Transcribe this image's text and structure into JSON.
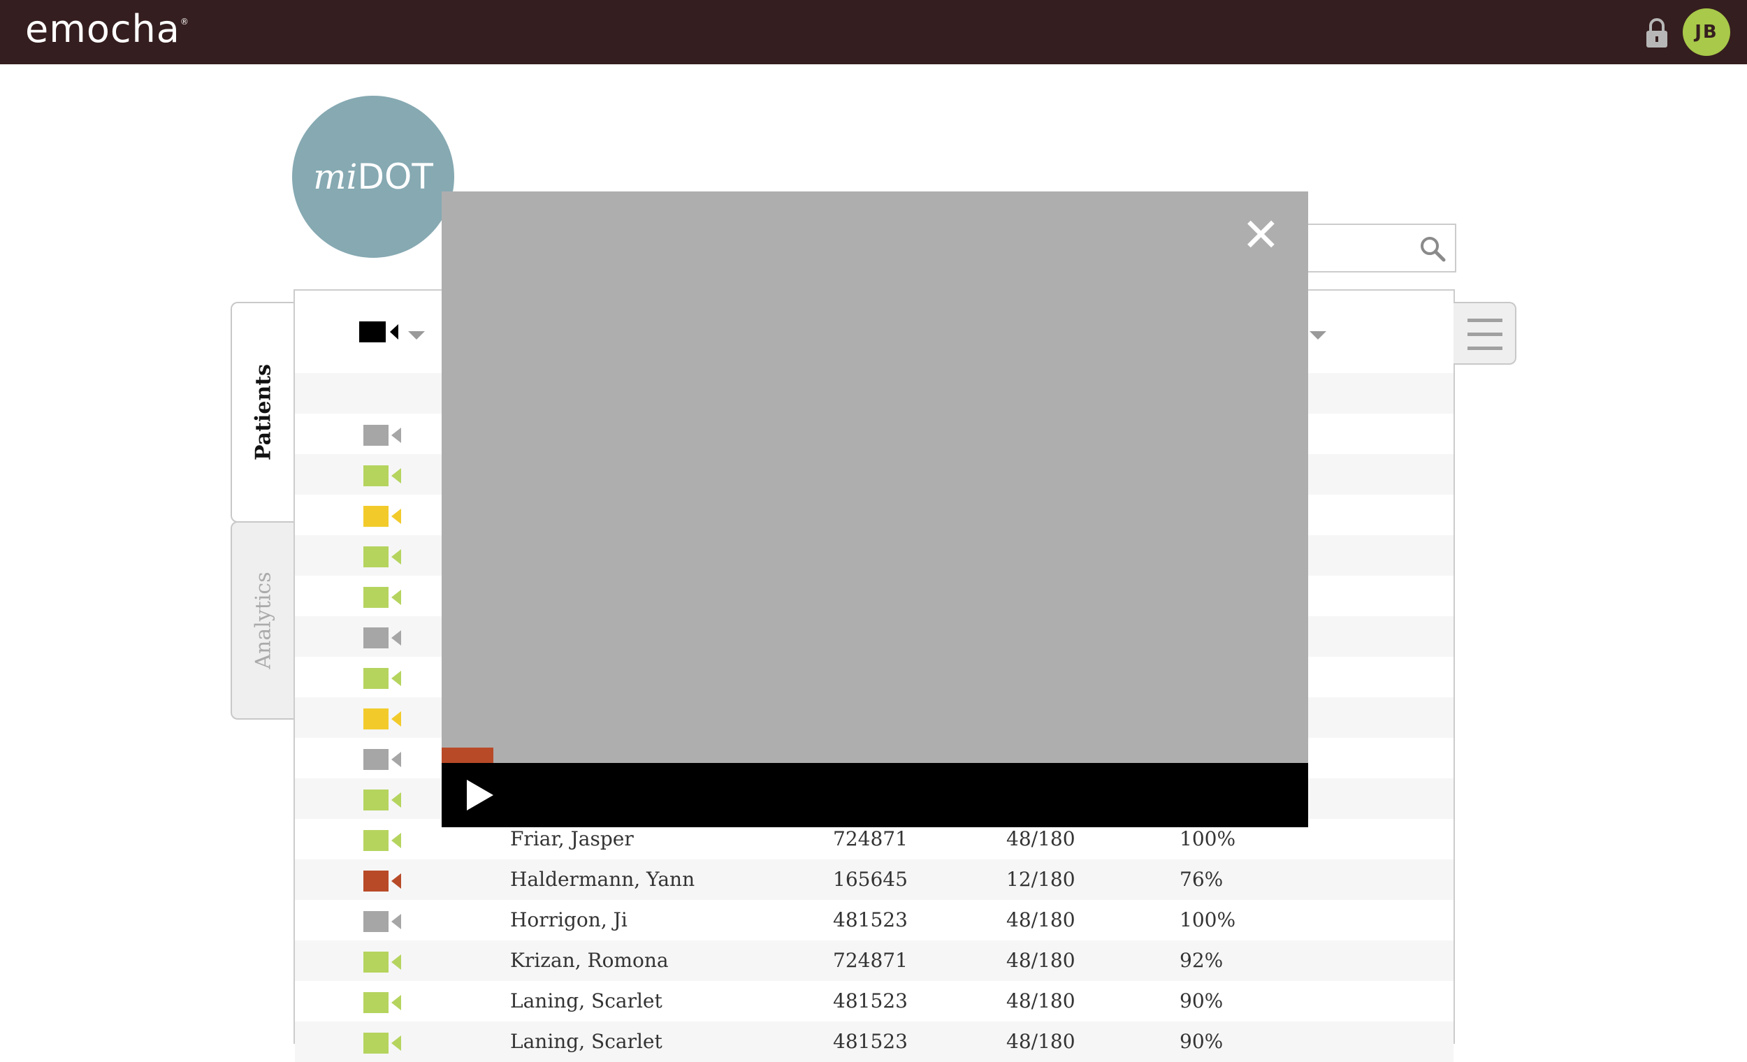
{
  "header": {
    "brand": "emocha",
    "brand_mark": "®",
    "lock_icon": "lock-icon",
    "avatar_initials": "JB",
    "avatar_color": "#a8c94a",
    "bg_color": "#351e1f"
  },
  "app": {
    "badge_prefix": "mi",
    "badge_name": "DOT"
  },
  "tabs": {
    "patients": "Patients",
    "analytics": "Analytics"
  },
  "search": {
    "placeholder": ""
  },
  "status_colors": {
    "gray": "#a6a6a6",
    "green": "#b5d45e",
    "yellow": "#f2cb2b",
    "red": "#b84a28",
    "black": "#000000"
  },
  "rows": [
    {
      "status": "none"
    },
    {
      "status": "gray"
    },
    {
      "status": "green"
    },
    {
      "status": "yellow"
    },
    {
      "status": "green"
    },
    {
      "status": "green"
    },
    {
      "status": "gray"
    },
    {
      "status": "green"
    },
    {
      "status": "yellow"
    },
    {
      "status": "gray"
    },
    {
      "status": "green"
    },
    {
      "status": "green",
      "name": "Friar, Jasper",
      "id": "724871",
      "doses": "48/180",
      "adherence": "100%"
    },
    {
      "status": "red",
      "name": "Haldermann, Yann",
      "id": "165645",
      "doses": "12/180",
      "adherence": "76%"
    },
    {
      "status": "gray",
      "name": "Horrigon, Ji",
      "id": "481523",
      "doses": "48/180",
      "adherence": "100%"
    },
    {
      "status": "green",
      "name": "Krizan, Romona",
      "id": "724871",
      "doses": "48/180",
      "adherence": "92%"
    },
    {
      "status": "green",
      "name": "Laning, Scarlet",
      "id": "481523",
      "doses": "48/180",
      "adherence": "90%"
    },
    {
      "status": "green",
      "name": "Laning, Scarlet",
      "id": "481523",
      "doses": "48/180",
      "adherence": "90%"
    }
  ],
  "video": {
    "close_label": "✕",
    "progress_percent": 6
  }
}
